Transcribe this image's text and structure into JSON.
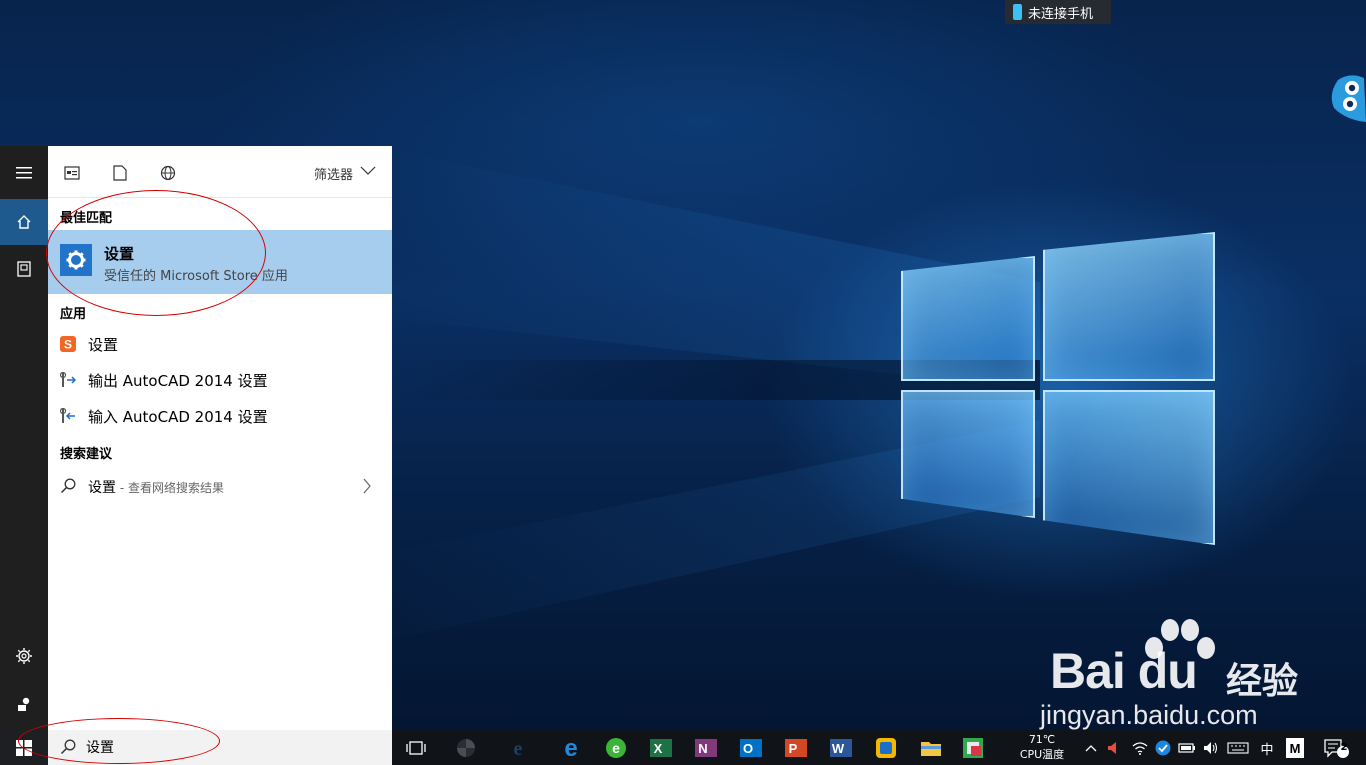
{
  "notification": {
    "phone_text": "未连接手机"
  },
  "start_menu": {
    "filter_label": "筛选器",
    "best_match_header": "最佳匹配",
    "best_match": {
      "title": "设置",
      "subtitle": "受信任的 Microsoft Store 应用"
    },
    "apps_header": "应用",
    "apps": [
      {
        "label": "设置",
        "icon": "sogou-settings-icon"
      },
      {
        "label": "输出 AutoCAD 2014 设置",
        "icon": "autocad-export-icon"
      },
      {
        "label": "输入 AutoCAD 2014 设置",
        "icon": "autocad-import-icon"
      }
    ],
    "suggestions_header": "搜索建议",
    "suggestion": {
      "query": "设置",
      "hint": " - 查看网络搜索结果"
    }
  },
  "search": {
    "value": "设置"
  },
  "taskbar": {
    "apps": [
      "task-view",
      "fan-app",
      "ie",
      "edge",
      "360-browser",
      "excel",
      "onenote",
      "outlook",
      "powerpoint",
      "word",
      "vpn-app",
      "file-explorer",
      "green-app"
    ],
    "app_letters": {
      "excel": "X",
      "onenote": "N",
      "outlook": "O",
      "powerpoint": "P",
      "word": "W"
    },
    "temperature": "71℃",
    "temp_label": "CPU温度",
    "ime": "中",
    "ime_mode": "M",
    "notifications_count": "2"
  },
  "watermark": {
    "brand": "Bai du",
    "brand_cn": "经验",
    "url": "jingyan.baidu.com"
  },
  "colors": {
    "accent": "#2274c9",
    "selected": "#a7cdee",
    "rail": "#1f1f1f",
    "annotation": "#d40000"
  }
}
